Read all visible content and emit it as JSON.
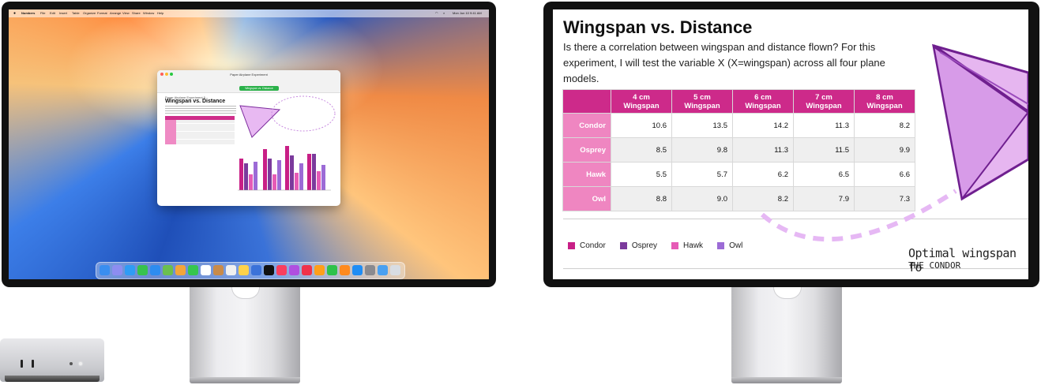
{
  "left_display": {
    "menu_items": [
      "Numbers",
      "File",
      "Edit",
      "Insert",
      "Table",
      "Organize",
      "Format",
      "Arrange",
      "View",
      "Share",
      "Window",
      "Help"
    ],
    "clock": "Mon Jun 10  9:41 AM",
    "window": {
      "title": "Paper Airplane Experiment",
      "sheet_tab": "Wingspan vs. Distance",
      "doc_subtitle": "Paper Airplane Experiment 5",
      "doc_heading": "Wingspan vs. Distance"
    }
  },
  "document": {
    "title": "Wingspan vs. Distance",
    "body": "Is there a correlation between wingspan and distance flown? For this experiment, I will test the variable X (X=wingspan) across all four plane models.",
    "table": {
      "headers": [
        "",
        "4 cm Wingspan",
        "5 cm Wingspan",
        "6 cm Wingspan",
        "7 cm Wingspan",
        "8 cm Wingspan"
      ],
      "rows": [
        {
          "label": "Condor",
          "values": [
            "10.6",
            "13.5",
            "14.2",
            "11.3",
            "8.2"
          ]
        },
        {
          "label": "Osprey",
          "values": [
            "8.5",
            "9.8",
            "11.3",
            "11.5",
            "9.9"
          ]
        },
        {
          "label": "Hawk",
          "values": [
            "5.5",
            "5.7",
            "6.2",
            "6.5",
            "6.6"
          ]
        },
        {
          "label": "Owl",
          "values": [
            "8.8",
            "9.0",
            "8.2",
            "7.9",
            "7.3"
          ]
        }
      ]
    },
    "legend": [
      {
        "name": "Condor",
        "color": "#c81f86"
      },
      {
        "name": "Osprey",
        "color": "#7b3a9c"
      },
      {
        "name": "Hawk",
        "color": "#e65bb6"
      },
      {
        "name": "Owl",
        "color": "#9c6bd6"
      }
    ],
    "annotation_line1": "Optimal wingspan fo",
    "annotation_line2": "THE CONDOR"
  }
}
